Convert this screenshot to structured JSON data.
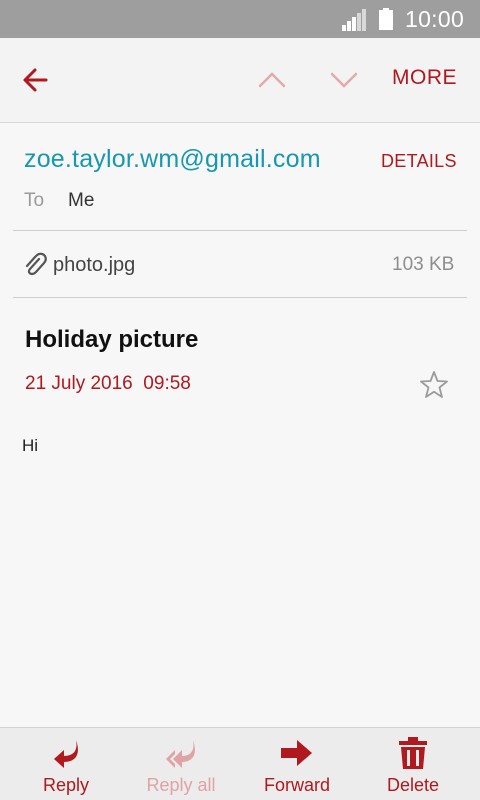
{
  "status_bar": {
    "time": "10:00",
    "signal_icon": "signal-icon",
    "battery_icon": "battery-icon"
  },
  "toolbar": {
    "back_icon": "arrow-left-icon",
    "prev_icon": "chevron-up-icon",
    "next_icon": "chevron-down-icon",
    "more_label": "MORE"
  },
  "message": {
    "sender": "zoe.taylor.wm@gmail.com",
    "details_label": "DETAILS",
    "to_label": "To",
    "to_value": "Me",
    "attachment": {
      "icon": "paperclip-icon",
      "name": "photo.jpg",
      "size": "103 KB"
    },
    "subject": "Holiday picture",
    "date": "21 July 2016  09:58",
    "star_icon": "star-outline-icon",
    "body": "Hi"
  },
  "bottom_bar": {
    "items": [
      {
        "label": "Reply",
        "icon": "reply-icon",
        "enabled": true
      },
      {
        "label": "Reply all",
        "icon": "reply-all-icon",
        "enabled": false
      },
      {
        "label": "Forward",
        "icon": "forward-icon",
        "enabled": true
      },
      {
        "label": "Delete",
        "icon": "trash-icon",
        "enabled": true
      }
    ]
  },
  "colors": {
    "accent": "#b0191e",
    "accent_disabled": "#e0a3a5",
    "sender_link": "#1797b0",
    "status_bar": "#9e9e9e"
  }
}
